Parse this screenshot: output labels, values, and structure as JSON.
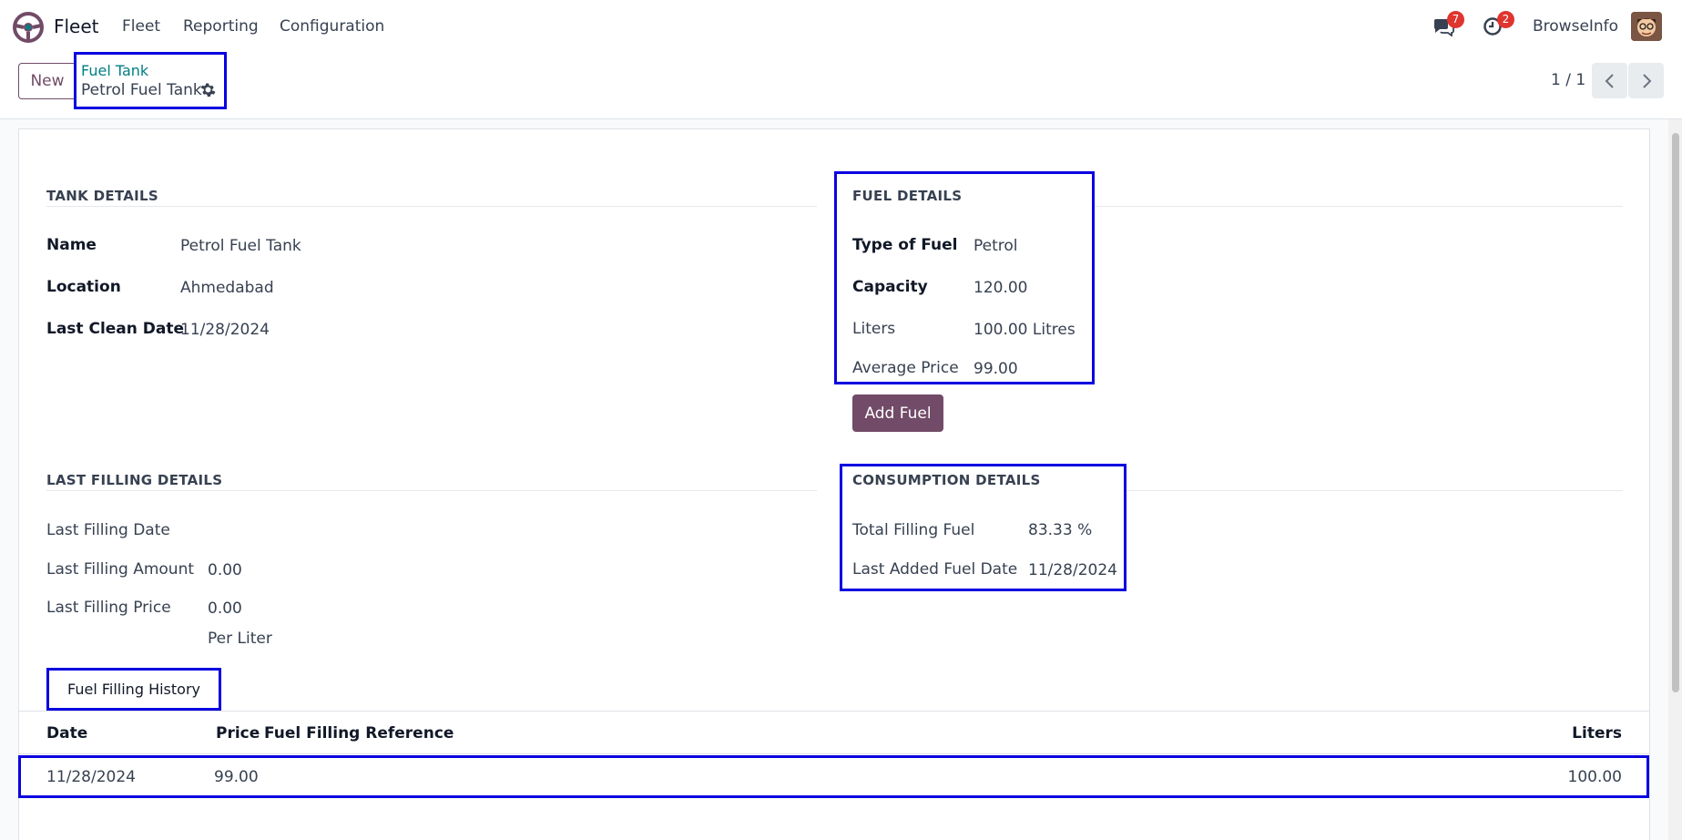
{
  "navbar": {
    "app_name": "Fleet",
    "menu": [
      "Fleet",
      "Reporting",
      "Configuration"
    ],
    "messages_badge": "7",
    "activities_badge": "2",
    "company": "BrowseInfo"
  },
  "control": {
    "new_label": "New",
    "breadcrumb_parent": "Fuel Tank",
    "breadcrumb_current": "Petrol Fuel Tank",
    "pager": "1 / 1"
  },
  "tank_details": {
    "title": "TANK DETAILS",
    "name_label": "Name",
    "name_value": "Petrol Fuel Tank",
    "location_label": "Location",
    "location_value": "Ahmedabad",
    "clean_label": "Last Clean Date",
    "clean_value": "11/28/2024"
  },
  "fuel_details": {
    "title": "FUEL DETAILS",
    "type_label": "Type of Fuel",
    "type_value": "Petrol",
    "capacity_label": "Capacity",
    "capacity_value": "120.00",
    "liters_label": "Liters",
    "liters_value": "100.00 Litres",
    "avg_label": "Average Price",
    "avg_value": "99.00",
    "add_fuel_label": "Add Fuel"
  },
  "last_filling": {
    "title": "LAST FILLING DETAILS",
    "date_label": "Last Filling Date",
    "date_value": "",
    "amount_label": "Last Filling Amount",
    "amount_value": "0.00",
    "price_label": "Last Filling Price",
    "price_value": "0.00",
    "price_unit": "Per Liter"
  },
  "consumption": {
    "title": "CONSUMPTION DETAILS",
    "total_label": "Total Filling Fuel",
    "total_value": "83.33 %",
    "last_added_label": "Last Added Fuel Date",
    "last_added_value": "11/28/2024"
  },
  "history": {
    "tab_label": "Fuel Filling History",
    "columns": [
      "Date",
      "Price",
      "Fuel Filling Reference",
      "Liters"
    ],
    "rows": [
      {
        "date": "11/28/2024",
        "price": "99.00",
        "reference": "",
        "liters": "100.00"
      }
    ]
  },
  "colors": {
    "brand": "#714b67",
    "link": "#017e84",
    "highlight": "#0a00e0",
    "badge": "#e0342f"
  }
}
